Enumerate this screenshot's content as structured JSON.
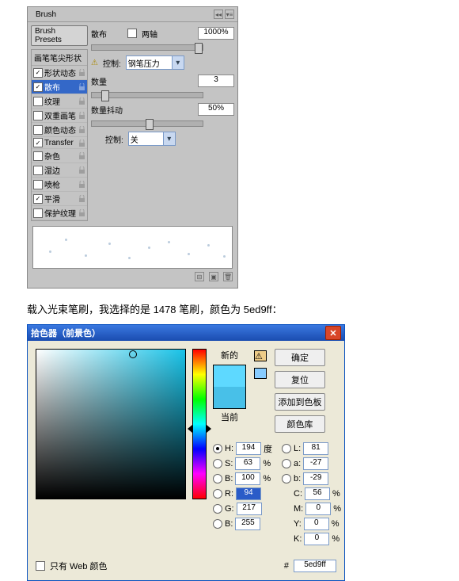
{
  "brush_panel": {
    "tab": "Brush",
    "presets_btn": "Brush Presets",
    "tip_header": "画笔笔尖形状",
    "settings": [
      {
        "label": "形状动态",
        "checked": true
      },
      {
        "label": "散布",
        "checked": true,
        "selected": true
      },
      {
        "label": "纹理",
        "checked": false
      },
      {
        "label": "双重画笔",
        "checked": false
      },
      {
        "label": "颜色动态",
        "checked": false
      },
      {
        "label": "Transfer",
        "checked": true
      },
      {
        "label": "杂色",
        "checked": false
      },
      {
        "label": "湿边",
        "checked": false
      },
      {
        "label": "喷枪",
        "checked": false
      },
      {
        "label": "平滑",
        "checked": true
      },
      {
        "label": "保护纹理",
        "checked": false
      }
    ],
    "scatter_label": "散布",
    "both_axes": "两轴",
    "scatter_value": "1000%",
    "control_label": "控制:",
    "control_value": "钢笔压力",
    "count_label": "数量",
    "count_value": "3",
    "jitter_label": "数量抖动",
    "jitter_value": "50%",
    "jitter_control_label": "控制:",
    "jitter_control_value": "关"
  },
  "caption": "载入光束笔刷，我选择的是 1478 笔刷，颜色为 5ed9ff：",
  "color_picker": {
    "title": "拾色器（前景色）",
    "new_label": "新的",
    "current_label": "当前",
    "ok": "确定",
    "cancel": "复位",
    "add": "添加到色板",
    "lib": "颜色库",
    "web_only": "只有 Web 颜色",
    "hex_prefix": "#",
    "hex": "5ed9ff",
    "hsb": {
      "H": "194",
      "S": "63",
      "B": "100"
    },
    "lab": {
      "L": "81",
      "a": "-27",
      "b": "-29"
    },
    "rgb": {
      "R": "94",
      "G": "217",
      "B": "255"
    },
    "cmyk": {
      "C": "56",
      "M": "0",
      "Y": "0",
      "K": "0"
    },
    "unit_deg": "度",
    "unit_pct": "%"
  }
}
